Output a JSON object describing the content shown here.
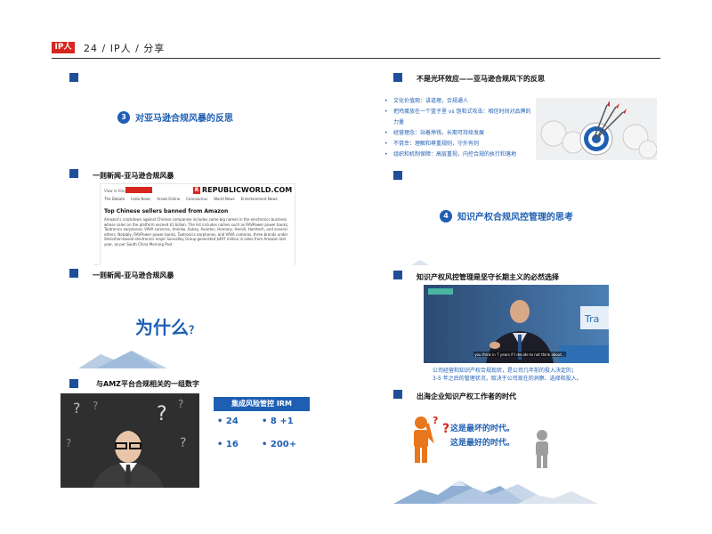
{
  "header": {
    "badge": "IP人",
    "text": "24 / IP人 / 分享"
  },
  "slides": {
    "s1": {
      "number": "3",
      "title": "对亚马逊合规风暴的反思"
    },
    "s2": {
      "title": "一则新闻-亚马逊合规风暴",
      "news": {
        "view_in": "View in Hindi",
        "brand": "REPUBLICWORLD.COM",
        "nav": [
          "The Debate",
          "India News",
          "Arnab Online",
          "Coronavirus",
          "World News",
          "Entertainment News"
        ],
        "headline": "Top Chinese sellers banned from Amazon",
        "body": "Amazon's crackdown against Chinese companies includes some big names in the electronics business whose sales on the platform exceed $1 billion. The list includes names such as RAVPower power banks, Taotronics earphones, VAVA cameras, Aminko, Aukey, Avantec, Homany, Hemili, Homtech, and several others. Notably, RAVPower power banks, Taotronics earphones, and VAVA cameras, three brands under Shenzhen-based electronics major Sunvalley Group generated $497 million in sales from Amazon last year, as per South China Morning Post."
      }
    },
    "s3": {
      "title": "一则新闻-亚马逊合规风暴",
      "big": "为什么",
      "q": "？"
    },
    "s4": {
      "title": "与AMZ平台合规相关的一组数字",
      "label": "集成风险管控 IRM",
      "numbers": [
        "24",
        "8 +1",
        "16",
        "200+"
      ]
    },
    "s5": {
      "title": "不是光环效应——亚马逊合规风下的反思",
      "bullets": [
        "文化价值观：讲道理，合规通人",
        "把鸡蛋放在一个篮子里 vs 饱和式攻击：相信时间对品牌的力量",
        "经营理念：站着挣钱，长期可持续发展",
        "不侥幸：理解和尊重规则，守外有则",
        "组织和机制保障：高层重视，内控合规的执行和落地"
      ]
    },
    "s6": {
      "number": "4",
      "title": "知识产权合规风控管理的思考"
    },
    "s7": {
      "title": "知识产权风控管理是坚守长期主义的必然选择",
      "caption_lines": [
        "公司经营和知识产权合规现状，是公司几年前的投入决定的；",
        "3-5 年之后的管理状况，取决于公司现在的洞察、选择和投入。"
      ],
      "video_sub": "you think in 7 years if I decide to not think about..."
    },
    "s8": {
      "title": "出海企业知识产权工作者的时代",
      "line1": "这是最坏的时代。",
      "line2": "这是最好的时代。"
    }
  },
  "colors": {
    "accent": "#1f5fb3",
    "square": "#1f4e9a",
    "red": "#d7261e",
    "orange": "#e8761c"
  }
}
